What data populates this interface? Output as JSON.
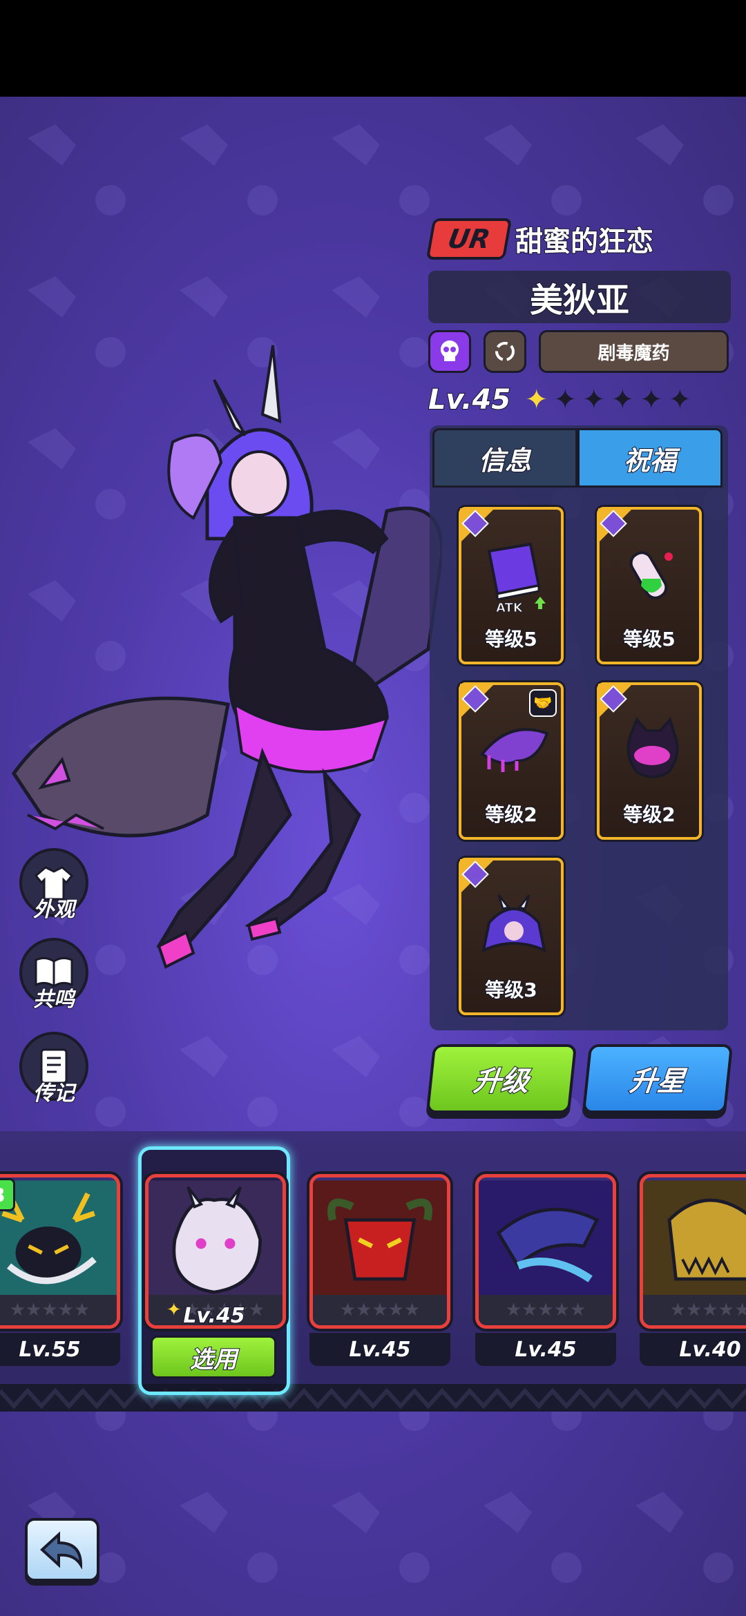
{
  "character": {
    "rarity": "UR",
    "title": "甜蜜的狂恋",
    "name": "美狄亚",
    "element_tag": "剧毒魔药",
    "level": "Lv.45",
    "stars_filled": 1,
    "stars_total": 6
  },
  "tabs": [
    {
      "label": "信息",
      "active": false
    },
    {
      "label": "祝福",
      "active": true
    }
  ],
  "blessings": [
    {
      "icon": "atk-book-icon",
      "caption": "ATK",
      "label": "等级5"
    },
    {
      "icon": "potion-icon",
      "label": "等级5"
    },
    {
      "icon": "bat-wing-icon",
      "label": "等级2",
      "locked": true
    },
    {
      "icon": "dark-cat-mask-icon",
      "label": "等级2"
    },
    {
      "icon": "horned-hood-icon",
      "label": "等级3"
    }
  ],
  "actions": {
    "upgrade": "升级",
    "star_up": "升星"
  },
  "side_menu": [
    {
      "icon": "shirt-icon",
      "label": "外观"
    },
    {
      "icon": "book-icon",
      "label": "共鸣"
    },
    {
      "icon": "journal-icon",
      "label": "传记"
    }
  ],
  "roster": [
    {
      "level": "Lv.55",
      "badge": "3",
      "art": "antlered-bird"
    },
    {
      "level": "Lv.45",
      "art": "white-dragon-ghost",
      "selected": true,
      "select_label": "选用"
    },
    {
      "level": "Lv.45",
      "art": "red-horned-demon"
    },
    {
      "level": "Lv.45",
      "art": "blue-dragon"
    },
    {
      "level": "Lv.40",
      "art": "gold-skull"
    }
  ],
  "colors": {
    "ur_badge": "#e83b3b",
    "panel_tab_active": "#3a9ee8",
    "upgrade_button": "#8ee030",
    "star_up_button": "#3aa0f5",
    "slot_border": "#f3b52a",
    "card_border": "#e8413d",
    "selected_glow": "#6ee8ff"
  }
}
